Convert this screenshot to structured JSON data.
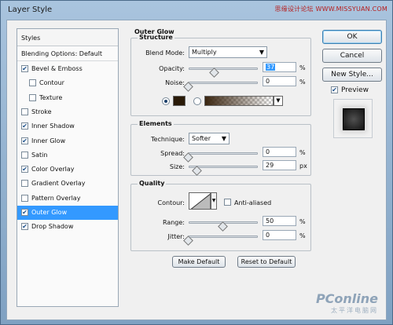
{
  "window": {
    "title": "Layer Style",
    "watermark_top": "思缘设计论坛 WWW.MISSYUAN.COM"
  },
  "styles_list": {
    "header": "Styles",
    "blending": "Blending Options: Default",
    "items": [
      {
        "label": "Bevel & Emboss",
        "checked": true,
        "indent": false
      },
      {
        "label": "Contour",
        "checked": false,
        "indent": true
      },
      {
        "label": "Texture",
        "checked": false,
        "indent": true
      },
      {
        "label": "Stroke",
        "checked": false,
        "indent": false
      },
      {
        "label": "Inner Shadow",
        "checked": true,
        "indent": false
      },
      {
        "label": "Inner Glow",
        "checked": true,
        "indent": false
      },
      {
        "label": "Satin",
        "checked": false,
        "indent": false
      },
      {
        "label": "Color Overlay",
        "checked": true,
        "indent": false
      },
      {
        "label": "Gradient Overlay",
        "checked": false,
        "indent": false
      },
      {
        "label": "Pattern Overlay",
        "checked": false,
        "indent": false
      },
      {
        "label": "Outer Glow",
        "checked": true,
        "indent": false,
        "selected": true
      },
      {
        "label": "Drop Shadow",
        "checked": true,
        "indent": false
      }
    ]
  },
  "outer_glow": {
    "section_title": "Outer Glow",
    "structure": {
      "title": "Structure",
      "blend_mode_label": "Blend Mode:",
      "blend_mode_value": "Multiply",
      "opacity_label": "Opacity:",
      "opacity_value": "37",
      "opacity_percent": 37,
      "noise_label": "Noise:",
      "noise_value": "0",
      "noise_percent": 0,
      "percent_unit": "%",
      "color_swatch": "#2a1a08"
    },
    "elements": {
      "title": "Elements",
      "technique_label": "Technique:",
      "technique_value": "Softer",
      "spread_label": "Spread:",
      "spread_value": "0",
      "spread_percent": 0,
      "size_label": "Size:",
      "size_value": "29",
      "size_fraction": 0.12,
      "percent_unit": "%",
      "px_unit": "px"
    },
    "quality": {
      "title": "Quality",
      "contour_label": "Contour:",
      "anti_aliased_label": "Anti-aliased",
      "anti_aliased_checked": false,
      "range_label": "Range:",
      "range_value": "50",
      "range_percent": 50,
      "jitter_label": "Jitter:",
      "jitter_value": "0",
      "jitter_percent": 0,
      "percent_unit": "%"
    },
    "buttons": {
      "make_default": "Make Default",
      "reset_default": "Reset to Default"
    }
  },
  "actions": {
    "ok": "OK",
    "cancel": "Cancel",
    "new_style": "New Style...",
    "preview_label": "Preview",
    "preview_checked": true
  },
  "watermark_bottom": {
    "brand": "PConline",
    "sub": "太平洋电脑网"
  }
}
